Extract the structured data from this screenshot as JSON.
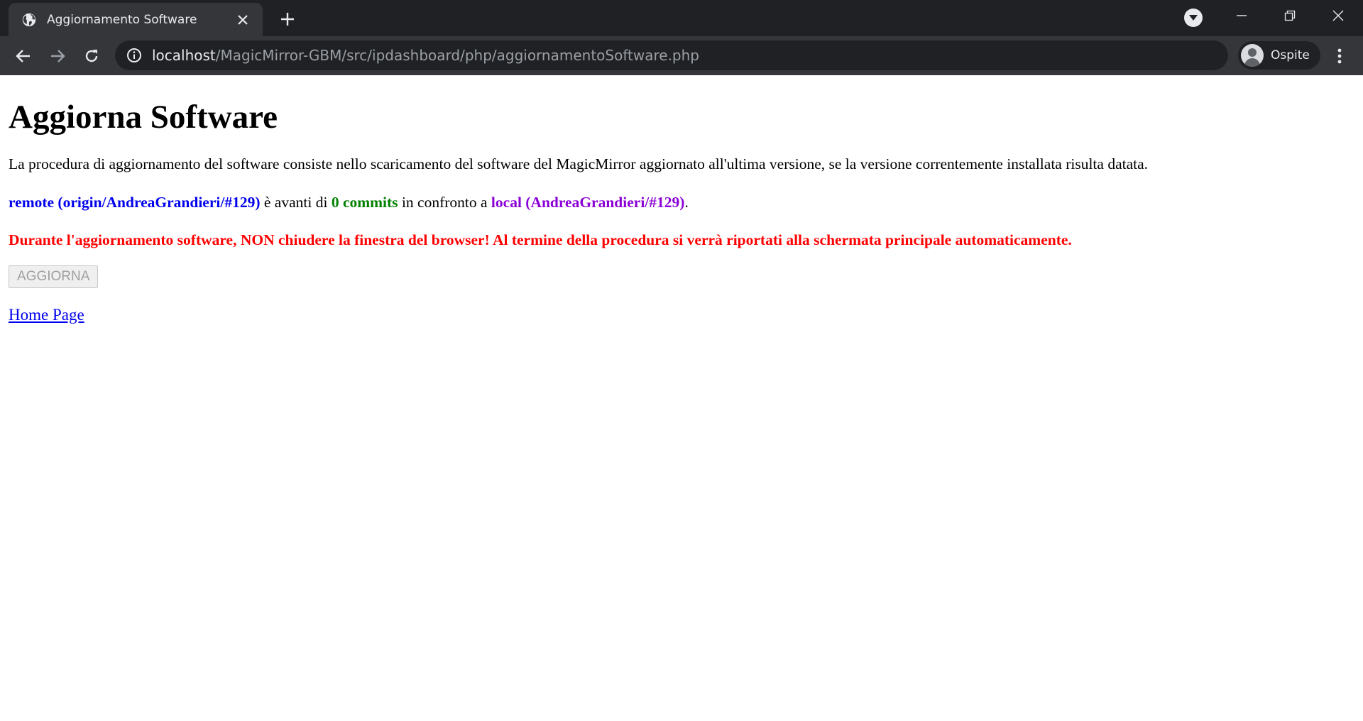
{
  "browser": {
    "tab_title": "Aggiornamento Software",
    "url_host": "localhost",
    "url_path": "/MagicMirror-GBM/src/ipdashboard/php/aggiornamentoSoftware.php",
    "profile_name": "Ospite"
  },
  "page": {
    "heading": "Aggiorna Software",
    "intro": "La procedura di aggiornamento del software consiste nello scaricamento del software del MagicMirror aggiornato all'ultima versione, se la versione correntemente installata risulta datata.",
    "status": {
      "remote": "remote (origin/AndreaGrandieri/#129)",
      "text1": " è avanti di ",
      "count": "0 commits",
      "text2": " in confronto a ",
      "local": "local (AndreaGrandieri/#129)",
      "text3": "."
    },
    "warning": "Durante l'aggiornamento software, NON chiudere la finestra del browser! Al termine della procedura si verrà riportati alla schermata principale automaticamente.",
    "update_button": "AGGIORNA",
    "home_link": "Home Page"
  },
  "colors": {
    "remote": "#0000ee",
    "count": "#008000",
    "local": "#8b00d6",
    "warning": "#ff0000",
    "chrome_bg": "#35363a",
    "tabstrip_bg": "#202124"
  }
}
